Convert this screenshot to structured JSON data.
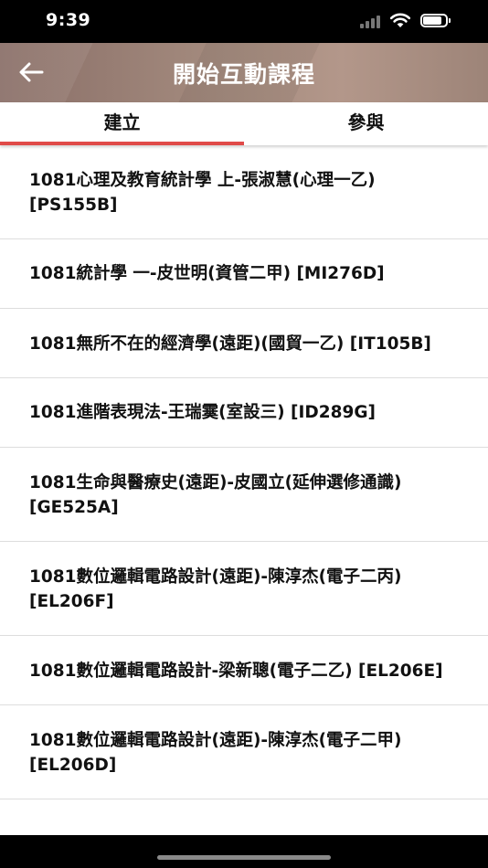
{
  "status_bar": {
    "time": "9:39",
    "signal_icon": "cellular-signal-icon",
    "wifi_icon": "wifi-icon",
    "battery_icon": "battery-icon",
    "battery_level": 0.85
  },
  "header": {
    "title": "開始互動課程",
    "back_icon": "arrow-left-icon"
  },
  "tabs": [
    {
      "label": "建立",
      "active": true
    },
    {
      "label": "參與",
      "active": false
    }
  ],
  "colors": {
    "accent": "#e04a48",
    "header_bg": "#a48b7e",
    "divider": "#dddddd"
  },
  "courses": [
    "1081心理及教育統計學 上-張淑慧(心理一乙) [PS155B]",
    "1081統計學 一-皮世明(資管二甲) [MI276D]",
    "1081無所不在的經濟學(遠距)(國貿一乙) [IT105B]",
    "1081進階表現法-王瑞霙(室設三) [ID289G]",
    "1081生命與醫療史(遠距)-皮國立(延伸選修通識) [GE525A]",
    "1081數位邏輯電路設計(遠距)-陳淳杰(電子二丙) [EL206F]",
    "1081數位邏輯電路設計-梁新聰(電子二乙) [EL206E]",
    "1081數位邏輯電路設計(遠距)-陳淳杰(電子二甲) [EL206D]"
  ]
}
